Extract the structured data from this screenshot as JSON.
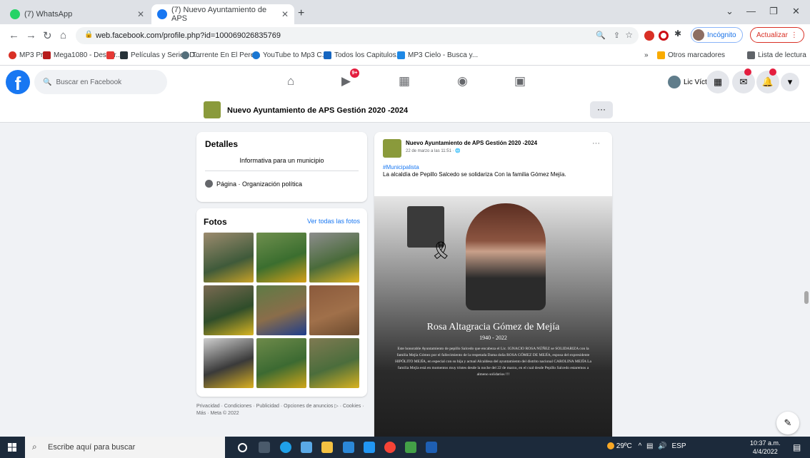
{
  "browser": {
    "tabs": [
      {
        "label": "(7) WhatsApp",
        "icon": "whatsapp-icon"
      },
      {
        "label": "(7) Nuevo Ayuntamiento de APS",
        "icon": "facebook-icon"
      }
    ],
    "url": "web.facebook.com/profile.php?id=100069026835769",
    "incognito_label": "Incógnito",
    "update_label": "Actualizar",
    "bookmarks": [
      "MP3 Pro",
      "Mega1080 - Descar...",
      "Películas y Series D...",
      "Torrente En El Pere...",
      "YouTube to Mp3 C...",
      "Todos los Capitulos...",
      "MP3 Cielo - Busca y..."
    ],
    "bookmarks_right": [
      "Otros marcadores",
      "Lista de lectura"
    ],
    "bookmarks_more": "»"
  },
  "facebook": {
    "search_placeholder": "Buscar en Facebook",
    "nav_badge": "9+",
    "profile_name": "Lic Víctor",
    "messenger_badge": "",
    "notif_badge": ""
  },
  "page": {
    "title": "Nuevo Ayuntamiento de APS Gestión 2020 -2024",
    "more_label": "···"
  },
  "details": {
    "heading": "Detalles",
    "description": "Informativa para un municipio",
    "category": "Página · Organización política"
  },
  "photos": {
    "heading": "Fotos",
    "see_all": "Ver todas las fotos"
  },
  "footer": "Privacidad · Condiciones · Publicidad · Opciones de anuncios ▷ · Cookies · Más · Meta © 2022",
  "post": {
    "author": "Nuevo Ayuntamiento de APS Gestión 2020 -2024",
    "meta": "22 de marzo a las 11:51 · 🌐",
    "menu": "···",
    "hashtag": "#Municipalista",
    "text": "La alcaldía de Pepillo Salcedo se solidariza Con la familia Gómez Mejía.",
    "memorial_name": "Rosa Altagracia Gómez de Mejía",
    "memorial_years": "1940 - 2022",
    "memorial_text": "Este honorable Ayuntamiento de pepillo Salcedo que encabeza el Lic. IGNACIO ROSA NÚÑEZ se SOLIDARIZA con la familia Mejía Gómez por el fallecimiento de la respetada Dama doña ROSA GÓMEZ DE MEJÍA, esposa del expresidente HIPÓLITO MEJÍA, en especial con su hija y actual Alcaldesa del ayuntamiento del distrito nacional CAROLINA MEJÍA La familia Mejía está en momentos muy tristes desde la noche del 22 de marzo, en el cual desde Pepillo Salcedo estaremos a almeno solidarios !!!"
  },
  "taskbar": {
    "search_placeholder": "Escribe aquí para buscar",
    "weather": "29ºC",
    "lang": "ESP",
    "time": "10:37 a.m.",
    "date": "4/4/2022"
  }
}
